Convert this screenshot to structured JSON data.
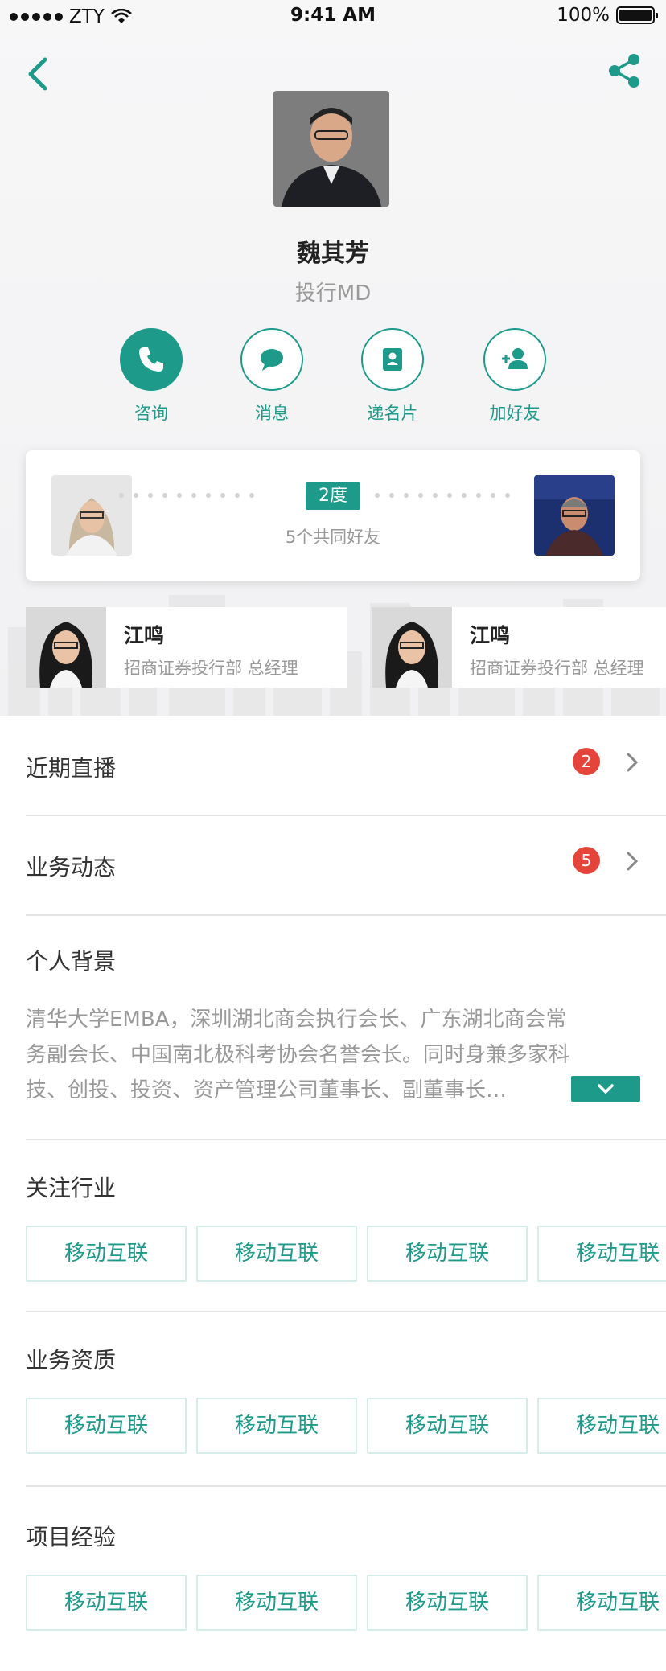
{
  "status_bar": {
    "carrier": "ZTY",
    "time": "9:41 AM",
    "battery": "100%"
  },
  "nav": {
    "back_icon": "chevron-left-icon",
    "share_icon": "share-icon"
  },
  "profile": {
    "name": "魏其芳",
    "title": "投行MD"
  },
  "actions": [
    {
      "label": "咨询",
      "icon": "phone-icon"
    },
    {
      "label": "消息",
      "icon": "chat-icon"
    },
    {
      "label": "递名片",
      "icon": "contact-card-icon"
    },
    {
      "label": "加好友",
      "icon": "add-friend-icon"
    }
  ],
  "connection": {
    "degree": "2度",
    "common_friends": "5个共同好友"
  },
  "friends": [
    {
      "name": "江鸣",
      "desc": "招商证券投行部 总经理"
    },
    {
      "name": "江鸣",
      "desc": "招商证券投行部 总经理"
    }
  ],
  "rows": [
    {
      "label": "近期直播",
      "badge": "2"
    },
    {
      "label": "业务动态",
      "badge": "5"
    }
  ],
  "background": {
    "title": "个人背景",
    "lines": [
      "清华大学EMBA，深圳湖北商会执行会长、广东湖北商会常",
      "务副会长、中国南北极科考协会名誉会长。同时身兼多家科",
      "技、创投、投资、资产管理公司董事长、副董事长…"
    ]
  },
  "sections": [
    {
      "title": "关注行业",
      "tags": [
        "移动互联",
        "移动互联",
        "移动互联",
        "移动互联"
      ]
    },
    {
      "title": "业务资质",
      "tags": [
        "移动互联",
        "移动互联",
        "移动互联",
        "移动互联"
      ]
    },
    {
      "title": "项目经验",
      "tags": [
        "移动互联",
        "移动互联",
        "移动互联",
        "移动互联"
      ]
    }
  ],
  "colors": {
    "accent": "#1d9a8a",
    "badge": "#e5443b"
  }
}
